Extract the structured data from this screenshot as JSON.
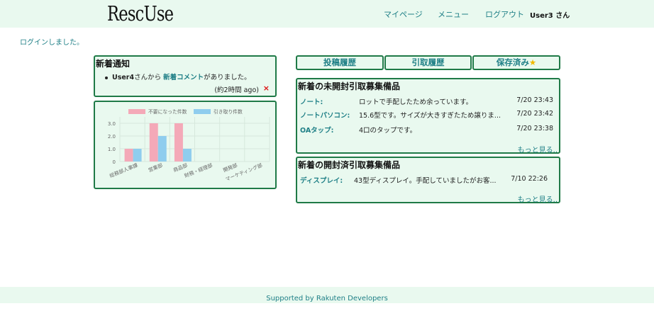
{
  "header": {
    "logo": "RescUse",
    "nav": {
      "mypage": "マイページ",
      "menu": "メニュー",
      "logout": "ログアウト",
      "user": "User3 さん"
    }
  },
  "flash": "ログインしました。",
  "notice": {
    "title": "新着通知",
    "user": "User4",
    "text_before": "さんから ",
    "link": "新着コメント",
    "text_after": "がありました。",
    "time": "(約2時間 ago)",
    "close": "×"
  },
  "tabs": {
    "posts": "投稿履歴",
    "pickups": "引取履歴",
    "saved": "保存済み",
    "saved_star": "★"
  },
  "unopened": {
    "title": "新着の未開封引取募集備品",
    "items": [
      {
        "name": "ノート:",
        "desc": "ロットで手配したため余っています。",
        "date": "7/20 23:43"
      },
      {
        "name": "ノートパソコン:",
        "desc": "15.6型です。サイズが大きすぎたため譲りま...",
        "date": "7/20 23:42"
      },
      {
        "name": "OAタップ:",
        "desc": "4口のタップです。",
        "date": "7/20 23:38"
      }
    ],
    "more": "もっと見る.."
  },
  "opened": {
    "title": "新着の開封済引取募集備品",
    "items": [
      {
        "name": "ディスプレイ:",
        "desc": "43型ディスプレイ。手配していましたがお客...",
        "date": "7/10 22:26"
      }
    ],
    "more": "もっと見る.."
  },
  "chart_data": {
    "type": "bar",
    "categories": [
      "総務部人事課",
      "営業部",
      "商品部",
      "財務・経理部",
      "開発部",
      "マーケティング部"
    ],
    "series": [
      {
        "name": "不要になった件数",
        "values": [
          1,
          3,
          3,
          0,
          0,
          0
        ],
        "color": "#f4a9b8"
      },
      {
        "name": "引き取り件数",
        "values": [
          1,
          2,
          1,
          0,
          0,
          0
        ],
        "color": "#8fcdee"
      }
    ],
    "y_ticks": [
      "0",
      "1.0",
      "2.0",
      "3.0"
    ],
    "ylim": [
      0,
      3.5
    ],
    "grid": true,
    "legend": "top"
  },
  "footer": "Supported by Rakuten Developers"
}
